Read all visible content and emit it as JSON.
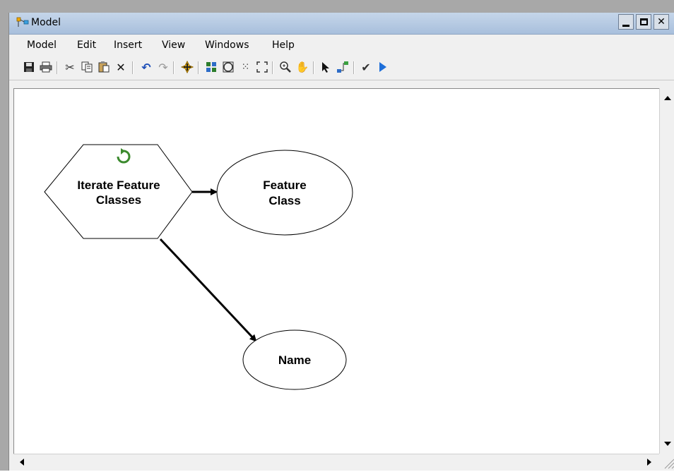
{
  "window": {
    "title": "Model"
  },
  "menu": [
    "Model",
    "Edit",
    "Insert",
    "View",
    "Windows",
    "Help"
  ],
  "toolbar_icons": [
    "save-icon",
    "print-icon",
    "cut-icon",
    "copy-icon",
    "paste-icon",
    "delete-icon",
    "undo-icon",
    "redo-icon",
    "add-data-icon",
    "auto-layout-icon",
    "full-extent-icon",
    "fixed-zoom-in-icon",
    "fixed-zoom-out-icon",
    "zoom-in-icon",
    "pan-icon",
    "select-icon",
    "connect-icon",
    "validate-icon",
    "run-icon"
  ],
  "model": {
    "iterator": {
      "line1": "Iterate Feature",
      "line2": "Classes"
    },
    "feature_class": {
      "line1": "Feature",
      "line2": "Class"
    },
    "name": {
      "label": "Name"
    }
  },
  "colors": {
    "iterator_arrow": "#3c8a2e",
    "run": "#1e6fd9",
    "validate": "#333333"
  }
}
